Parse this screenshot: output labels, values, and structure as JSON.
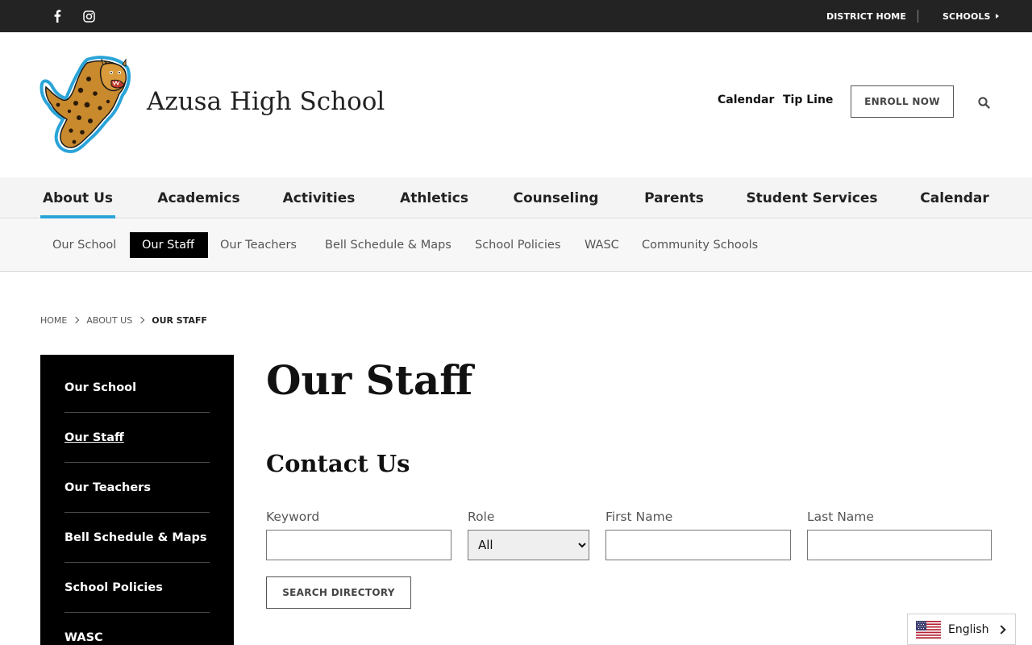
{
  "topbar": {
    "social": [
      {
        "icon": "facebook-icon"
      },
      {
        "icon": "instagram-icon"
      }
    ],
    "district_home": "DISTRICT HOME",
    "schools": "SCHOOLS"
  },
  "header": {
    "site_name": "Azusa High School",
    "calendar": "Calendar",
    "tip_line": "Tip Line",
    "enroll": "ENROLL NOW",
    "search_icon": "search-icon"
  },
  "main_nav": [
    {
      "label": "About Us",
      "active": true
    },
    {
      "label": "Academics"
    },
    {
      "label": "Activities"
    },
    {
      "label": "Athletics"
    },
    {
      "label": "Counseling"
    },
    {
      "label": "Parents"
    },
    {
      "label": "Student Services"
    },
    {
      "label": "Calendar"
    }
  ],
  "sub_nav": [
    {
      "label": "Our School"
    },
    {
      "label": "Our Staff",
      "active": true
    },
    {
      "label": "Our Teachers"
    },
    {
      "label": "Bell Schedule & Maps"
    },
    {
      "label": "School Policies"
    },
    {
      "label": "WASC"
    },
    {
      "label": "Community Schools"
    }
  ],
  "breadcrumb": {
    "home": "HOME",
    "section": "ABOUT US",
    "current": "OUR STAFF"
  },
  "side_nav": [
    {
      "label": "Our School"
    },
    {
      "label": "Our Staff",
      "active": true
    },
    {
      "label": "Our Teachers"
    },
    {
      "label": "Bell Schedule & Maps"
    },
    {
      "label": "School Policies"
    },
    {
      "label": "WASC"
    }
  ],
  "content": {
    "title": "Our Staff",
    "section_title": "Contact Us",
    "keyword_label": "Keyword",
    "keyword_value": "",
    "role_label": "Role",
    "role_selected": "All",
    "first_name_label": "First Name",
    "first_name_value": "",
    "last_name_label": "Last Name",
    "last_name_value": "",
    "search_button": "SEARCH DIRECTORY"
  },
  "language": {
    "label": "English",
    "flag_icon": "us-flag-icon"
  },
  "colors": {
    "topbar_bg": "#232323",
    "accent": "#2aa4d8",
    "active_bg": "#000000"
  }
}
